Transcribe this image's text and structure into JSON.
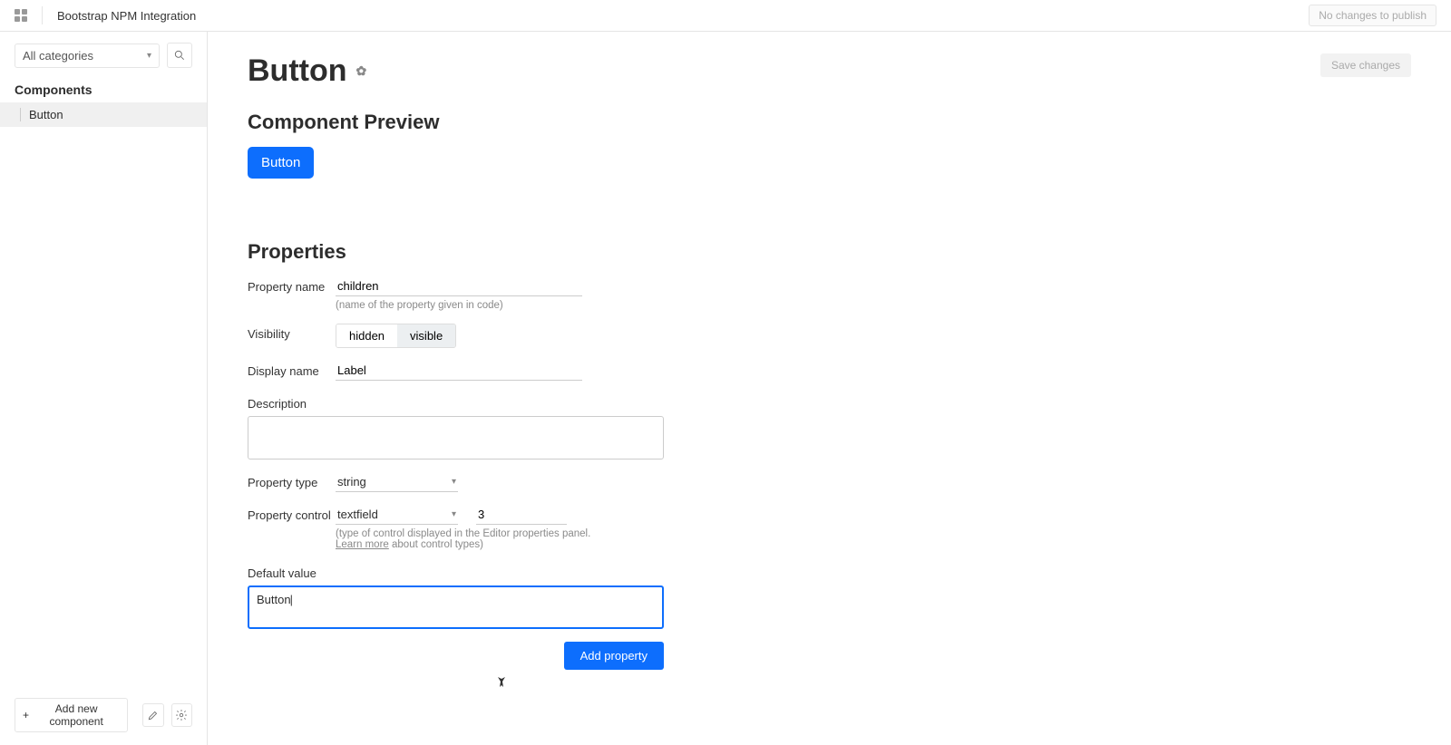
{
  "topbar": {
    "title": "Bootstrap NPM Integration",
    "publish_label": "No changes to publish"
  },
  "sidebar": {
    "category_label": "All categories",
    "section_label": "Components",
    "items": [
      "Button"
    ],
    "add_component_label": "Add new component"
  },
  "main": {
    "title": "Button",
    "save_label": "Save changes",
    "preview_heading": "Component Preview",
    "preview_button_label": "Button",
    "properties_heading": "Properties",
    "form": {
      "property_name_label": "Property name",
      "property_name_value": "children",
      "property_name_hint": "(name of the property given in code)",
      "visibility_label": "Visibility",
      "visibility_hidden": "hidden",
      "visibility_visible": "visible",
      "display_name_label": "Display name",
      "display_name_value": "Label",
      "description_label": "Description",
      "description_value": "",
      "property_type_label": "Property type",
      "property_type_value": "string",
      "property_control_label": "Property control",
      "property_control_value": "textfield",
      "property_control_rows": "3",
      "property_control_hint_prefix": "(type of control displayed in the Editor properties panel. ",
      "property_control_learn_more": "Learn more",
      "property_control_hint_suffix": " about control types)",
      "default_value_label": "Default value",
      "default_value_value": "Button",
      "add_property_label": "Add property"
    }
  }
}
